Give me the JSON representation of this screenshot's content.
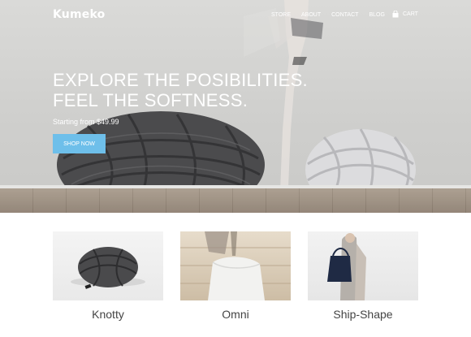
{
  "brand": {
    "logo": "Kumeko"
  },
  "nav": {
    "items": [
      {
        "label": "STORE"
      },
      {
        "label": "ABOUT"
      },
      {
        "label": "CONTACT"
      },
      {
        "label": "BLOG"
      }
    ],
    "cart_label": "CART"
  },
  "hero": {
    "headline_line1": "EXPLORE THE POSIBILITIES.",
    "headline_line2": "FEEL THE SOFTNESS.",
    "price_text": "Starting from $49.99",
    "cta_label": "SHOP NOW"
  },
  "products": [
    {
      "name": "Knotty"
    },
    {
      "name": "Omni"
    },
    {
      "name": "Ship-Shape"
    }
  ],
  "colors": {
    "accent": "#6ebfea",
    "hero_bg": "#d3d3d1",
    "text_white": "#ffffff"
  }
}
